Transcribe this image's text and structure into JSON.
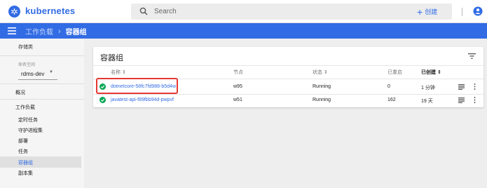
{
  "app": {
    "brand": "kubernetes",
    "colors": {
      "primary": "#326ce5",
      "running": "#00a651",
      "highlight": "#e53935"
    }
  },
  "topbar": {
    "search_placeholder": "Search",
    "create_label": "创建",
    "icons": [
      "kubernetes-logo",
      "search-icon",
      "plus-icon",
      "account-icon"
    ]
  },
  "breadcrumb": {
    "parent": "工作负载",
    "separator": "›",
    "current": "容器组"
  },
  "sidebar": {
    "cluster_heading": "存储类",
    "namespace_label": "命名空间",
    "namespace_value": "rdms-dev",
    "overview": "概况",
    "workloads": "工作负载",
    "items": [
      "定时任务",
      "守护进程集",
      "部署",
      "任务",
      "容器组",
      "副本集"
    ],
    "active_item": "容器组"
  },
  "card": {
    "title": "容器组",
    "columns": {
      "name": "名称 ⇕",
      "node": "节点",
      "status": "状态 ⇕",
      "restarts": "已重启",
      "created": "已创建 ⇕"
    },
    "rows": [
      {
        "name": "dotnetcore-58fc7fd988-b5d4w",
        "node": "w95",
        "status": "Running",
        "restarts": "0",
        "created": "1 分钟",
        "highlighted": true
      },
      {
        "name": "javatest-api-f89fbb94d-pwpvf",
        "node": "w51",
        "status": "Running",
        "restarts": "162",
        "created": "19 天",
        "highlighted": false
      }
    ]
  }
}
